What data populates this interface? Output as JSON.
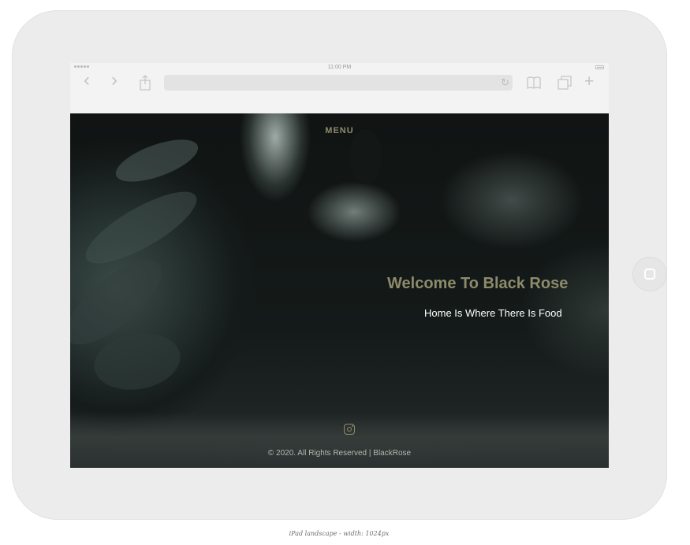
{
  "status_bar": {
    "time": "11:00 PM"
  },
  "toolbar": {
    "back_glyph": "‹",
    "forward_glyph": "›",
    "reload_glyph": "↻",
    "add_glyph": "+",
    "icons": [
      "chevron-left-icon",
      "chevron-right-icon",
      "share-icon",
      "reload-icon",
      "bookmarks-icon",
      "tabs-icon",
      "plus-icon"
    ]
  },
  "site": {
    "menu_label": "MENU",
    "hero_title": "Welcome To Black Rose",
    "hero_subtitle": "Home Is Where There Is Food",
    "footer_text": "© 2020. All Rights Reserved | BlackRose",
    "social_icon": "instagram-icon",
    "accent_color": "#8d8b6a"
  },
  "caption": "iPad landscape - width: 1024px"
}
